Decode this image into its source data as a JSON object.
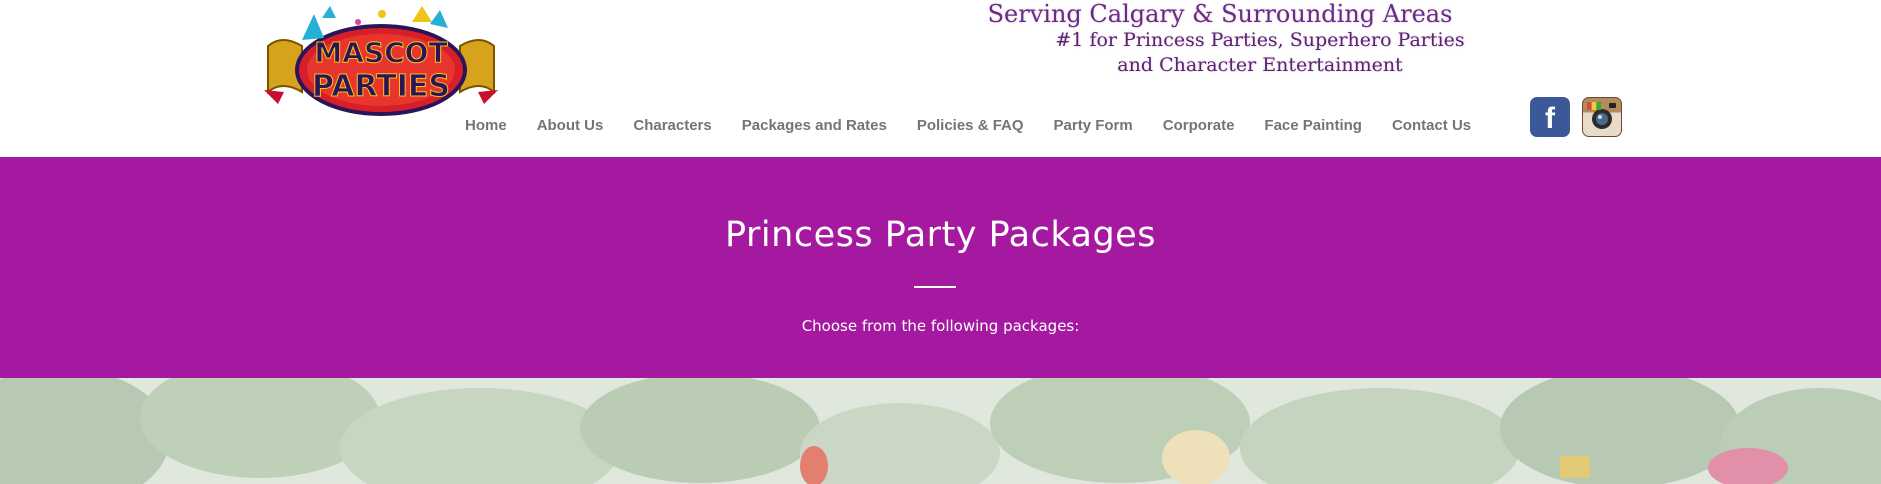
{
  "header": {
    "logo_text": "MASCOT PARTIES",
    "tagline_line1": "Serving Calgary & Surrounding Areas",
    "tagline_line2": "#1 for Princess Parties, Superhero Parties",
    "tagline_line3": "and Character Entertainment"
  },
  "nav": {
    "items": [
      "Home",
      "About Us",
      "Characters",
      "Packages and Rates",
      "Policies & FAQ",
      "Party Form",
      "Corporate",
      "Face Painting",
      "Contact Us"
    ]
  },
  "social": {
    "facebook_icon": "facebook-icon",
    "instagram_icon": "instagram-icon",
    "facebook_letter": "f"
  },
  "hero": {
    "title": "Princess Party Packages",
    "subtitle": "Choose from the following packages:",
    "background_color": "#a519a1"
  }
}
